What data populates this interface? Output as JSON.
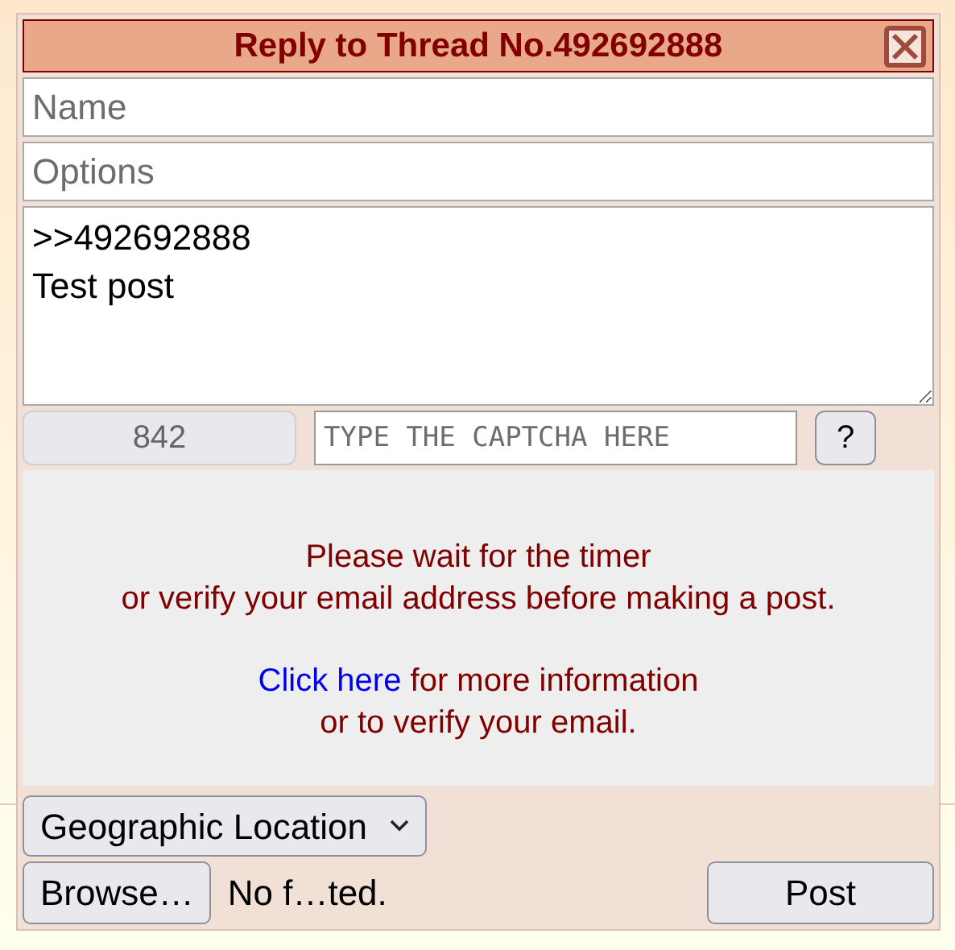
{
  "window": {
    "title": "Reply to Thread No.492692888"
  },
  "name_field": {
    "placeholder": "Name"
  },
  "options_field": {
    "placeholder": "Options"
  },
  "comment": {
    "value": ">>492692888\nTest post"
  },
  "char_counter": "842",
  "captcha": {
    "placeholder": "TYPE THE CAPTCHA HERE",
    "help": "?"
  },
  "notice": {
    "text": "Please wait for the timer\nor verify your email address before making a post.",
    "link": "Click here",
    "link_suffix": "for more information\nor to verify your email."
  },
  "location_select": {
    "value": "Geographic Location"
  },
  "file": {
    "button": "Browse…",
    "status": "No f…ted."
  },
  "submit": "Post"
}
